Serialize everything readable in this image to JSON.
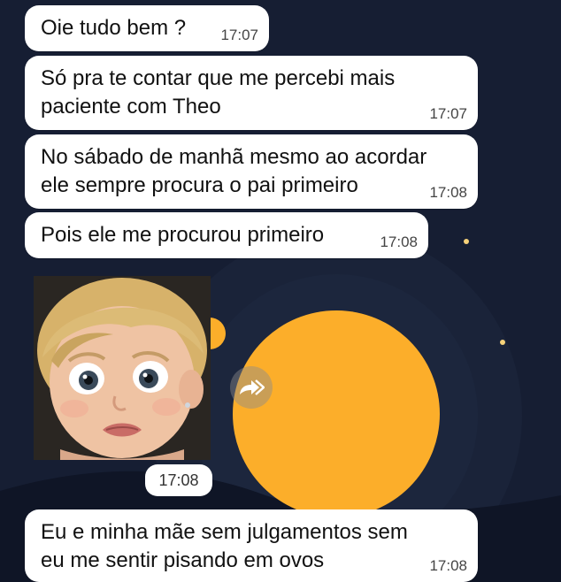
{
  "messages": [
    {
      "text_lines": [
        "Oie tudo bem ?"
      ],
      "time": "17:07"
    },
    {
      "text_lines": [
        "Só pra te contar que me percebi mais",
        "paciente com Theo"
      ],
      "time": "17:07"
    },
    {
      "text_lines": [
        "No sábado de manhã mesmo ao acordar",
        "ele sempre procura o pai primeiro"
      ],
      "time": "17:08"
    },
    {
      "text_lines": [
        "Pois ele me procurou primeiro"
      ],
      "time": "17:08"
    },
    {
      "text_lines": [
        "Eu e minha mãe sem julgamentos sem",
        "eu me sentir pisando em ovos"
      ],
      "time": "17:08"
    }
  ],
  "sticker": {
    "time": "17:08",
    "icon": "surprised-child-sticker"
  },
  "forward": {
    "icon": "forward-icon"
  },
  "colors": {
    "wallpaper": "#161e33",
    "bubble": "#ffffff",
    "accent_orange": "#fcae2a",
    "text": "#111111"
  }
}
